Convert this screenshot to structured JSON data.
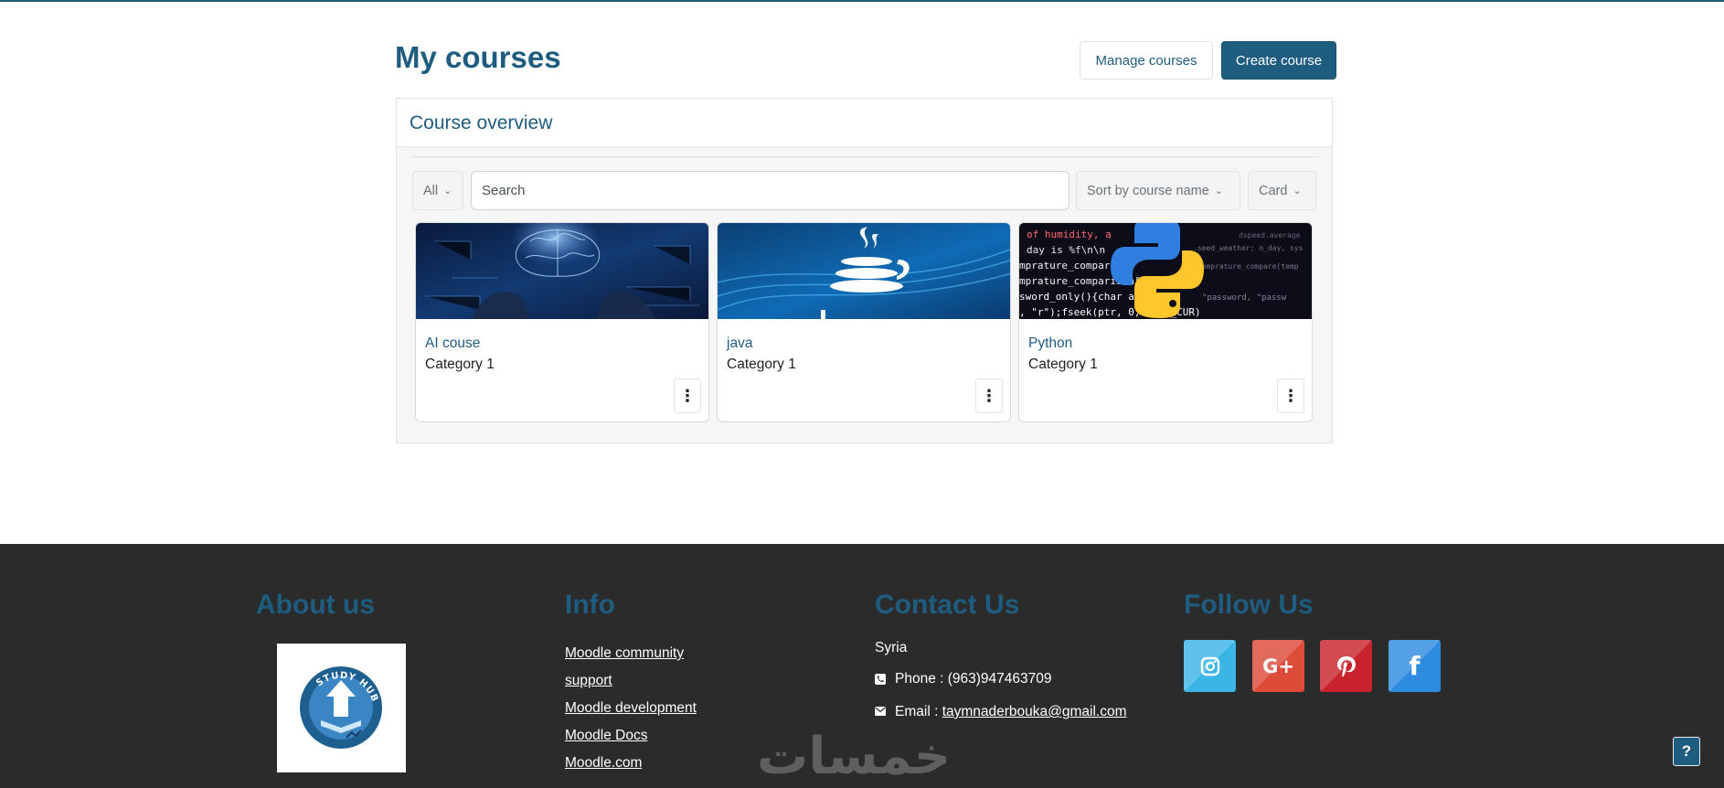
{
  "page": {
    "title": "My courses",
    "manage_label": "Manage courses",
    "create_label": "Create course"
  },
  "overview": {
    "title": "Course overview",
    "filter_value": "All",
    "search_placeholder": "Search",
    "sort_value": "Sort by course name",
    "view_value": "Card"
  },
  "courses": [
    {
      "name": "AI couse",
      "category": "Category 1",
      "image": "ai-brain-image"
    },
    {
      "name": "java",
      "category": "Category 1",
      "image": "java-logo-image"
    },
    {
      "name": "Python",
      "category": "Category 1",
      "image": "python-code-image"
    }
  ],
  "footer": {
    "about": {
      "heading": "About us",
      "logo_text": "STUDY HUB"
    },
    "info": {
      "heading": "Info",
      "links": [
        "Moodle community",
        "support",
        "Moodle development",
        "Moodle Docs",
        "Moodle.com"
      ]
    },
    "contact": {
      "heading": "Contact Us",
      "location": "Syria",
      "phone_label": "Phone : ",
      "phone": "(963)947463709",
      "email_label": "Email : ",
      "email": "taymnaderbouka@gmail.com"
    },
    "follow": {
      "heading": "Follow Us",
      "networks": [
        {
          "name": "instagram",
          "color": "#3ab5e6"
        },
        {
          "name": "google-plus",
          "color": "#dd4b39"
        },
        {
          "name": "pinterest",
          "color": "#c8232c"
        },
        {
          "name": "facebook",
          "color": "#2d8be0"
        }
      ]
    }
  },
  "watermark": "خمسات",
  "help_label": "?"
}
